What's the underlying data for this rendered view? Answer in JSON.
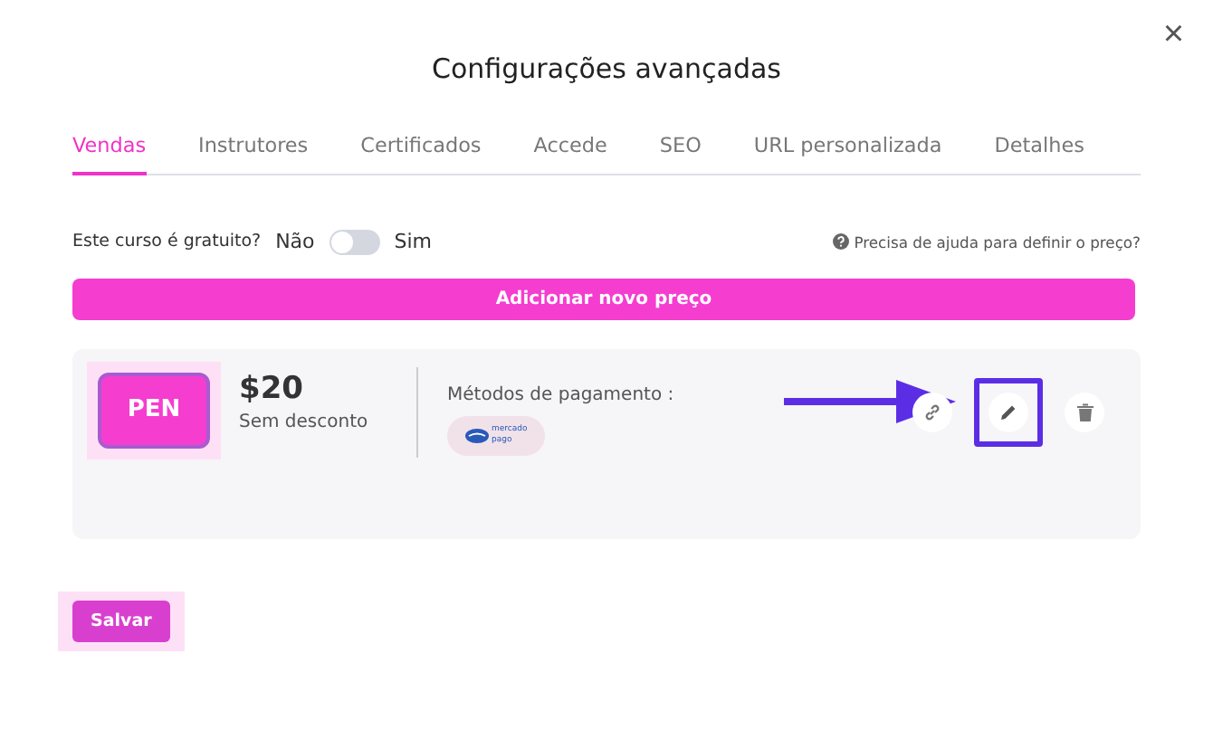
{
  "dialog": {
    "title": "Configurações avançadas",
    "close": "×"
  },
  "tabs": [
    {
      "label": "Vendas",
      "selected": true
    },
    {
      "label": "Instrutores",
      "selected": false
    },
    {
      "label": "Certificados",
      "selected": false
    },
    {
      "label": "Accede",
      "selected": false
    },
    {
      "label": "SEO",
      "selected": false
    },
    {
      "label": "URL personalizada",
      "selected": false
    },
    {
      "label": "Detalhes",
      "selected": false
    }
  ],
  "free_course": {
    "label": "Este curso é gratuito?",
    "off_label": "Não",
    "on_label": "Sim",
    "on": false
  },
  "help_link": "Precisa de ajuda para definir o preço?",
  "add_price_button": "Adicionar novo preço",
  "prices": [
    {
      "currency": "PEN",
      "amount": "$20",
      "discount": "Sem desconto",
      "payment_label": "Métodos de pagamento :",
      "payment_methods": [
        "mercado pago"
      ]
    }
  ],
  "save_button": "Salvar"
}
